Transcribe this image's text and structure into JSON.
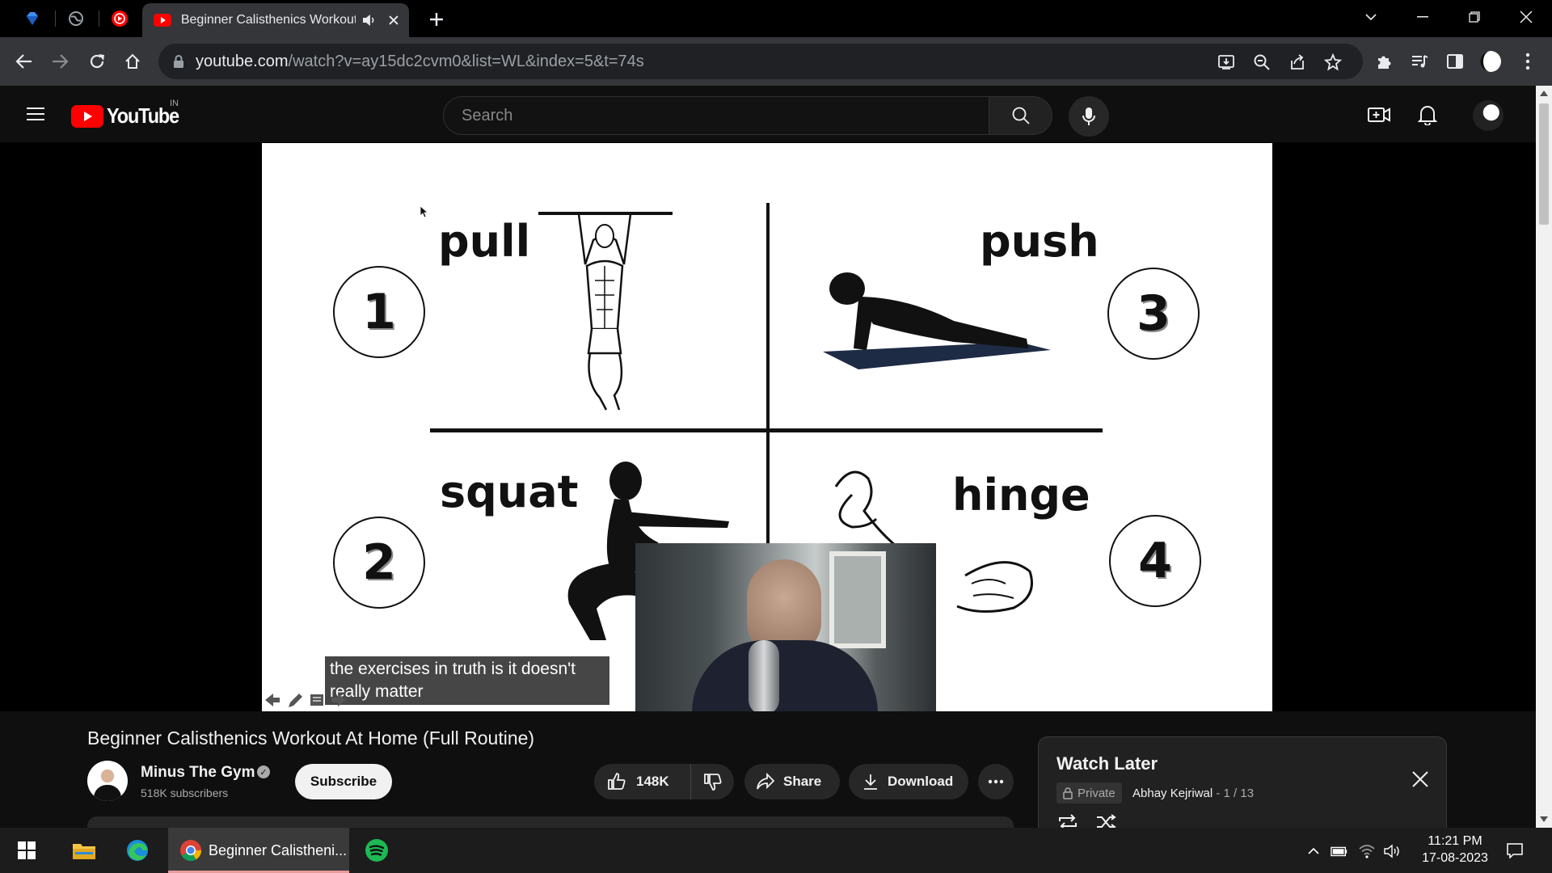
{
  "browser": {
    "pinned_tabs": [
      "gem-icon",
      "globe-icon",
      "youtube-music-icon"
    ],
    "active_tab": {
      "title": "Beginner Calisthenics Workout At Home (Full Routine)"
    },
    "url": {
      "host": "youtube.com",
      "path": "/watch?v=ay15dc2cvm0&list=WL&index=5&t=74s"
    }
  },
  "youtube": {
    "logo_text": "YouTube",
    "country_code": "IN",
    "search_placeholder": "Search"
  },
  "video": {
    "slide": {
      "labels": [
        "pull",
        "push",
        "squat",
        "hinge"
      ],
      "numbers": [
        "1",
        "3",
        "2",
        "4"
      ]
    },
    "caption_line1": "the exercises in truth is it doesn't",
    "caption_line2": "really matter",
    "title": "Beginner Calisthenics Workout At Home (Full Routine)",
    "channel_name": "Minus The Gym",
    "subscribers": "518K subscribers",
    "subscribe_label": "Subscribe",
    "likes": "148K",
    "share_label": "Share",
    "download_label": "Download"
  },
  "watch_later": {
    "title": "Watch Later",
    "privacy": "Private",
    "owner": "Abhay Kejriwal",
    "position": " - 1 / 13"
  },
  "taskbar": {
    "chrome_title": "Beginner Calistheni...",
    "time": "11:21 PM",
    "date": "17-08-2023"
  },
  "colors": {
    "youtube_red": "#ff0000",
    "page_bg": "#0f0f0f",
    "chrome_toolbar": "#35363a",
    "accent_underline": "#e89b9b"
  }
}
